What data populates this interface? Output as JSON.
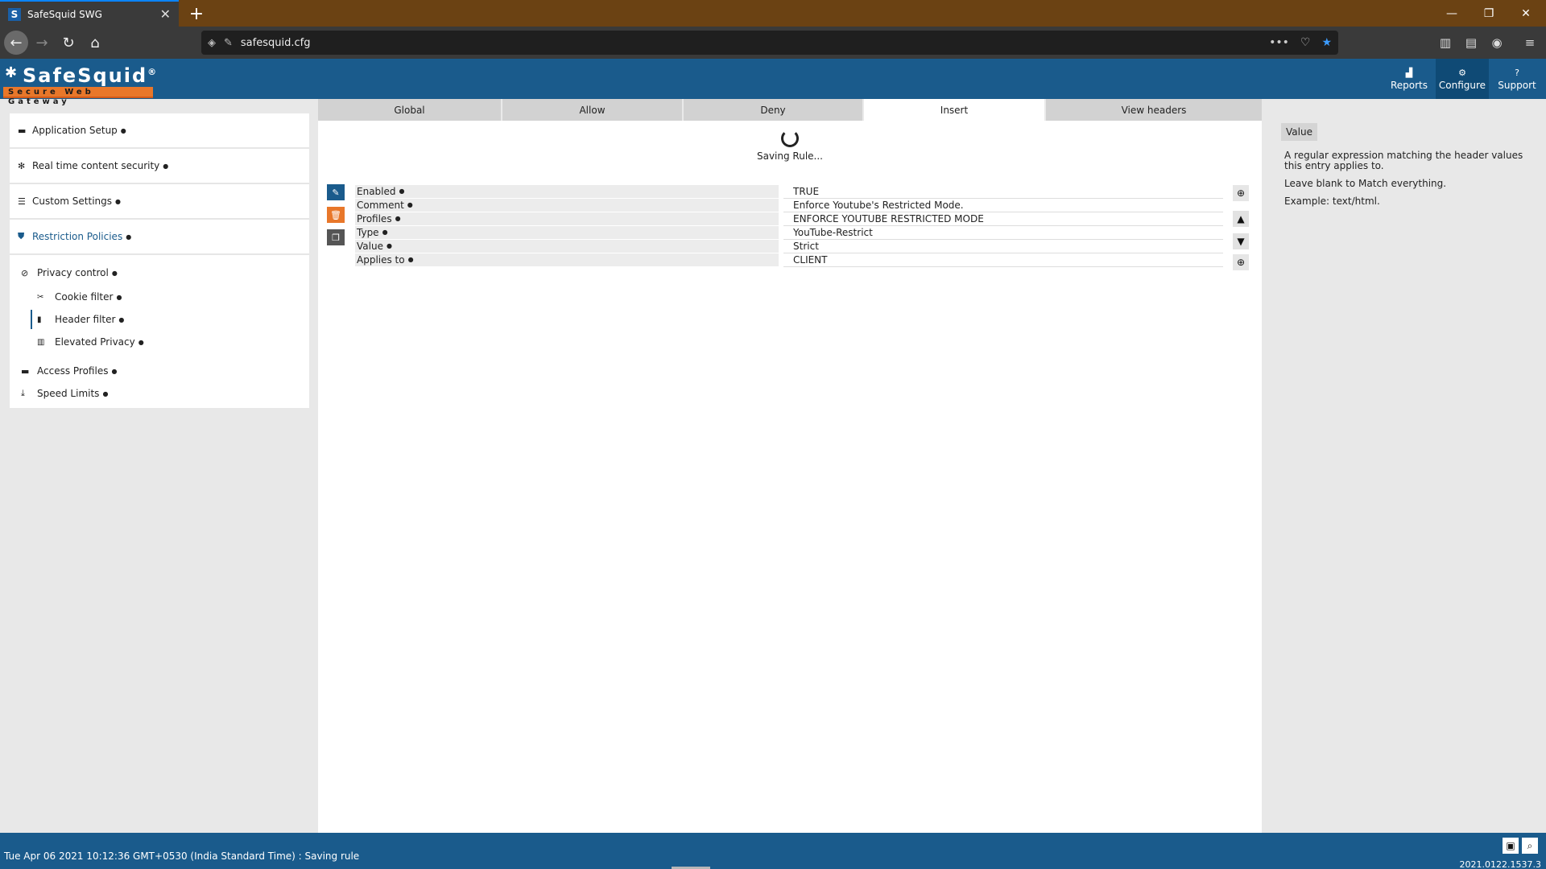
{
  "browser": {
    "tab_title": "SafeSquid SWG",
    "tab_favicon": "S",
    "url": "safesquid.cfg"
  },
  "header": {
    "brand": "SafeSquid",
    "brand_mark": "®",
    "tagline": "Secure Web Gateway",
    "nav": [
      {
        "label": "Reports",
        "icon": "chart-icon"
      },
      {
        "label": "Configure",
        "icon": "configure-icon"
      },
      {
        "label": "Support",
        "icon": "help-icon"
      }
    ]
  },
  "sidebar": {
    "items": [
      {
        "label": "Application Setup"
      },
      {
        "label": "Real time content security"
      },
      {
        "label": "Custom Settings"
      },
      {
        "label": "Restriction Policies"
      }
    ],
    "privacy": {
      "label": "Privacy control",
      "children": [
        {
          "label": "Cookie filter"
        },
        {
          "label": "Header filter"
        },
        {
          "label": "Elevated Privacy"
        }
      ]
    },
    "bottom": [
      {
        "label": "Access Profiles"
      },
      {
        "label": "Speed Limits"
      }
    ]
  },
  "main": {
    "tabs": [
      {
        "label": "Global"
      },
      {
        "label": "Allow"
      },
      {
        "label": "Deny"
      },
      {
        "label": "Insert"
      },
      {
        "label": "View headers"
      }
    ],
    "active_tab": "Insert",
    "saving_text": "Saving Rule...",
    "rule": [
      {
        "label": "Enabled",
        "value": "TRUE"
      },
      {
        "label": "Comment",
        "value": "Enforce Youtube's Restricted Mode."
      },
      {
        "label": "Profiles",
        "value": "ENFORCE YOUTUBE RESTRICTED MODE"
      },
      {
        "label": "Type",
        "value": "YouTube-Restrict"
      },
      {
        "label": "Value",
        "value": "Strict"
      },
      {
        "label": "Applies to",
        "value": "CLIENT"
      }
    ]
  },
  "help": {
    "title": "Value",
    "lines": [
      "A regular expression matching the header values this entry applies to.",
      "Leave blank to Match everything.",
      "Example: text/html."
    ]
  },
  "footer": {
    "status": "Tue Apr 06 2021 10:12:36 GMT+0530 (India Standard Time) : Saving rule",
    "version": "2021.0122.1537.3"
  },
  "colors": {
    "brand_blue": "#1a5b8c",
    "accent_orange": "#e8772a",
    "browser_tabbar": "#6b4213"
  }
}
